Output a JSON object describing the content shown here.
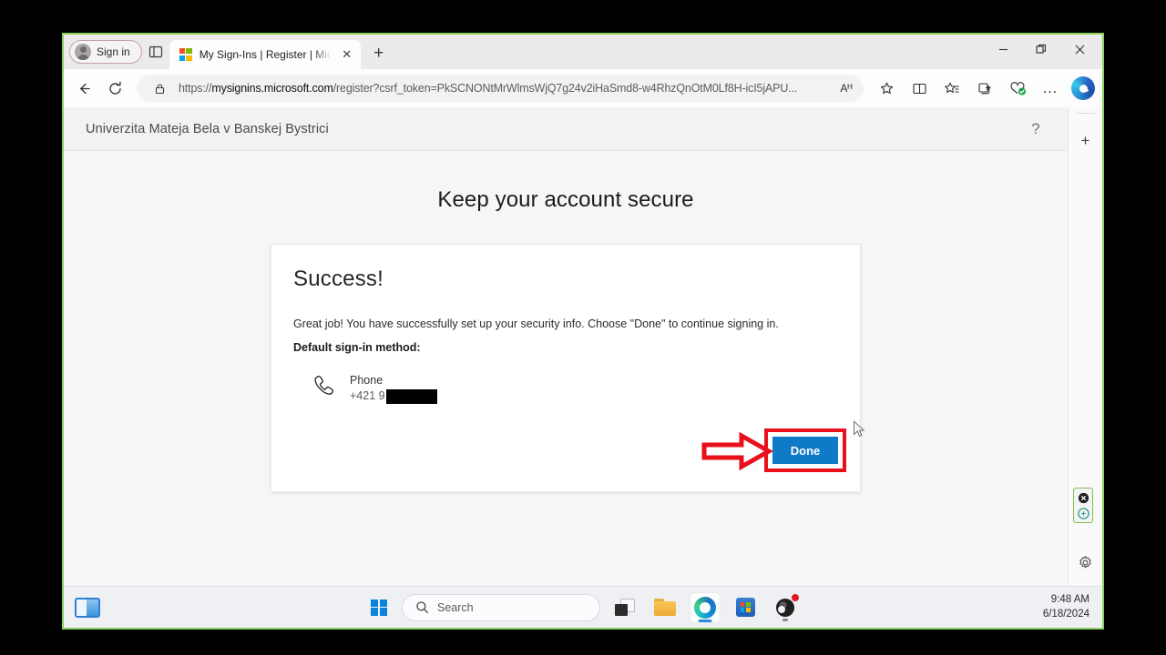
{
  "browser": {
    "signin_label": "Sign in",
    "tab": {
      "title": "My Sign-Ins | Register | Microsoft",
      "favicon": "microsoft-logo-icon",
      "close_label": "✕"
    },
    "newtab_label": "+",
    "window_controls": {
      "minimize": "–",
      "restore": "❐",
      "close": "✕"
    },
    "toolbar": {
      "back_label": "←",
      "refresh_label": "⟳",
      "url_scheme": "https://",
      "url_host": "mysignins.microsoft.com",
      "url_path": "/register?csrf_token=PkSCNONtMrWlmsWjQ7g24v2iHaSmd8-w4RhzQnOtM0Lf8H-icI5jAPU...",
      "url_full": "https://mysignins.microsoft.com/register?csrf_token=PkSCNONtMrWlmsWjQ7g24v2iHaSmd8-w4RhzQnOtM0Lf8H-icI5jAPU...",
      "read_aloud_label": "Aᴴ",
      "favorite_label": "☆",
      "icons": [
        "lock-icon",
        "read-aloud-icon",
        "add-favorite-icon",
        "split-screen-icon",
        "favorites-icon",
        "collections-icon",
        "browser-essentials-icon",
        "more-options-icon",
        "copilot-icon"
      ],
      "more_label": "…"
    },
    "right_rail": {
      "add_label": "+",
      "settings_label": "gear-icon",
      "widget": {
        "close_label": "✕",
        "app_label": "e"
      }
    }
  },
  "page": {
    "org_name": "Univerzita Mateja Bela v Banskej Bystrici",
    "help_label": "?",
    "title": "Keep your account secure",
    "card": {
      "heading": "Success!",
      "description": "Great job! You have successfully set up your security info. Choose \"Done\" to continue signing in.",
      "default_method_label": "Default sign-in method:",
      "method": {
        "icon": "phone-icon",
        "name": "Phone",
        "number_prefix": "+421 9",
        "number_redacted": true
      },
      "done_button": "Done"
    },
    "annotation": {
      "highlight_color": "#e8111b",
      "arrow": "red-arrow-pointing-right",
      "target": "done-button"
    }
  },
  "taskbar": {
    "widgets_label": "widgets-icon",
    "start_label": "start-icon",
    "search_placeholder": "Search",
    "apps": [
      {
        "name": "task-view-icon",
        "active": false,
        "badge": false
      },
      {
        "name": "file-explorer-icon",
        "active": false,
        "badge": false
      },
      {
        "name": "microsoft-edge-icon",
        "active": true,
        "badge": false
      },
      {
        "name": "microsoft-store-icon",
        "active": false,
        "badge": false
      },
      {
        "name": "obs-studio-icon",
        "active": false,
        "badge": true
      }
    ],
    "clock": {
      "time": "9:48 AM",
      "date": "6/18/2024"
    }
  },
  "colors": {
    "accent_blue": "#0f7ac8",
    "annotation_red": "#e8111b",
    "capture_border_green": "#8dd35f",
    "taskbar_bg": "#eef0f3"
  }
}
